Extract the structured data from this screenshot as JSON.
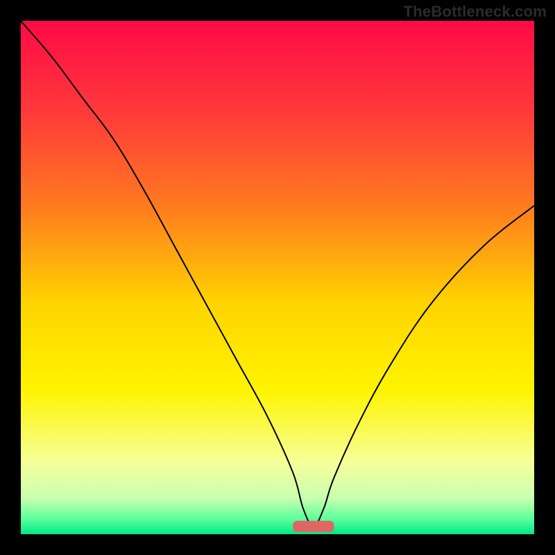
{
  "watermark": "TheBottleneck.com",
  "chart_data": {
    "type": "line",
    "title": "",
    "xlabel": "",
    "ylabel": "",
    "xlim": [
      0,
      100
    ],
    "ylim": [
      0,
      100
    ],
    "grid": false,
    "legend": false,
    "background": {
      "type": "vertical-gradient",
      "stops": [
        {
          "pos": 0.0,
          "color": "#ff0a46"
        },
        {
          "pos": 0.18,
          "color": "#ff3a3a"
        },
        {
          "pos": 0.36,
          "color": "#ff7a1f"
        },
        {
          "pos": 0.55,
          "color": "#ffd400"
        },
        {
          "pos": 0.72,
          "color": "#fff400"
        },
        {
          "pos": 0.86,
          "color": "#f6ff9a"
        },
        {
          "pos": 0.93,
          "color": "#c9ffb0"
        },
        {
          "pos": 0.97,
          "color": "#5cff9c"
        },
        {
          "pos": 1.0,
          "color": "#00e886"
        }
      ]
    },
    "marker": {
      "x": 57,
      "y": 1.5,
      "width": 8,
      "height": 2.2,
      "color": "#e06666",
      "shape": "rounded-rect"
    },
    "series": [
      {
        "name": "bottleneck-curve",
        "color": "#000000",
        "stroke_width": 2,
        "x": [
          0,
          6,
          12,
          18,
          24,
          30,
          36,
          42,
          48,
          53,
          55,
          57,
          59,
          61,
          66,
          72,
          80,
          90,
          100
        ],
        "y": [
          100,
          93,
          85,
          77,
          67,
          56,
          45,
          34,
          23,
          12,
          5,
          1.5,
          5,
          11,
          22,
          33,
          45,
          56,
          64
        ]
      }
    ]
  }
}
